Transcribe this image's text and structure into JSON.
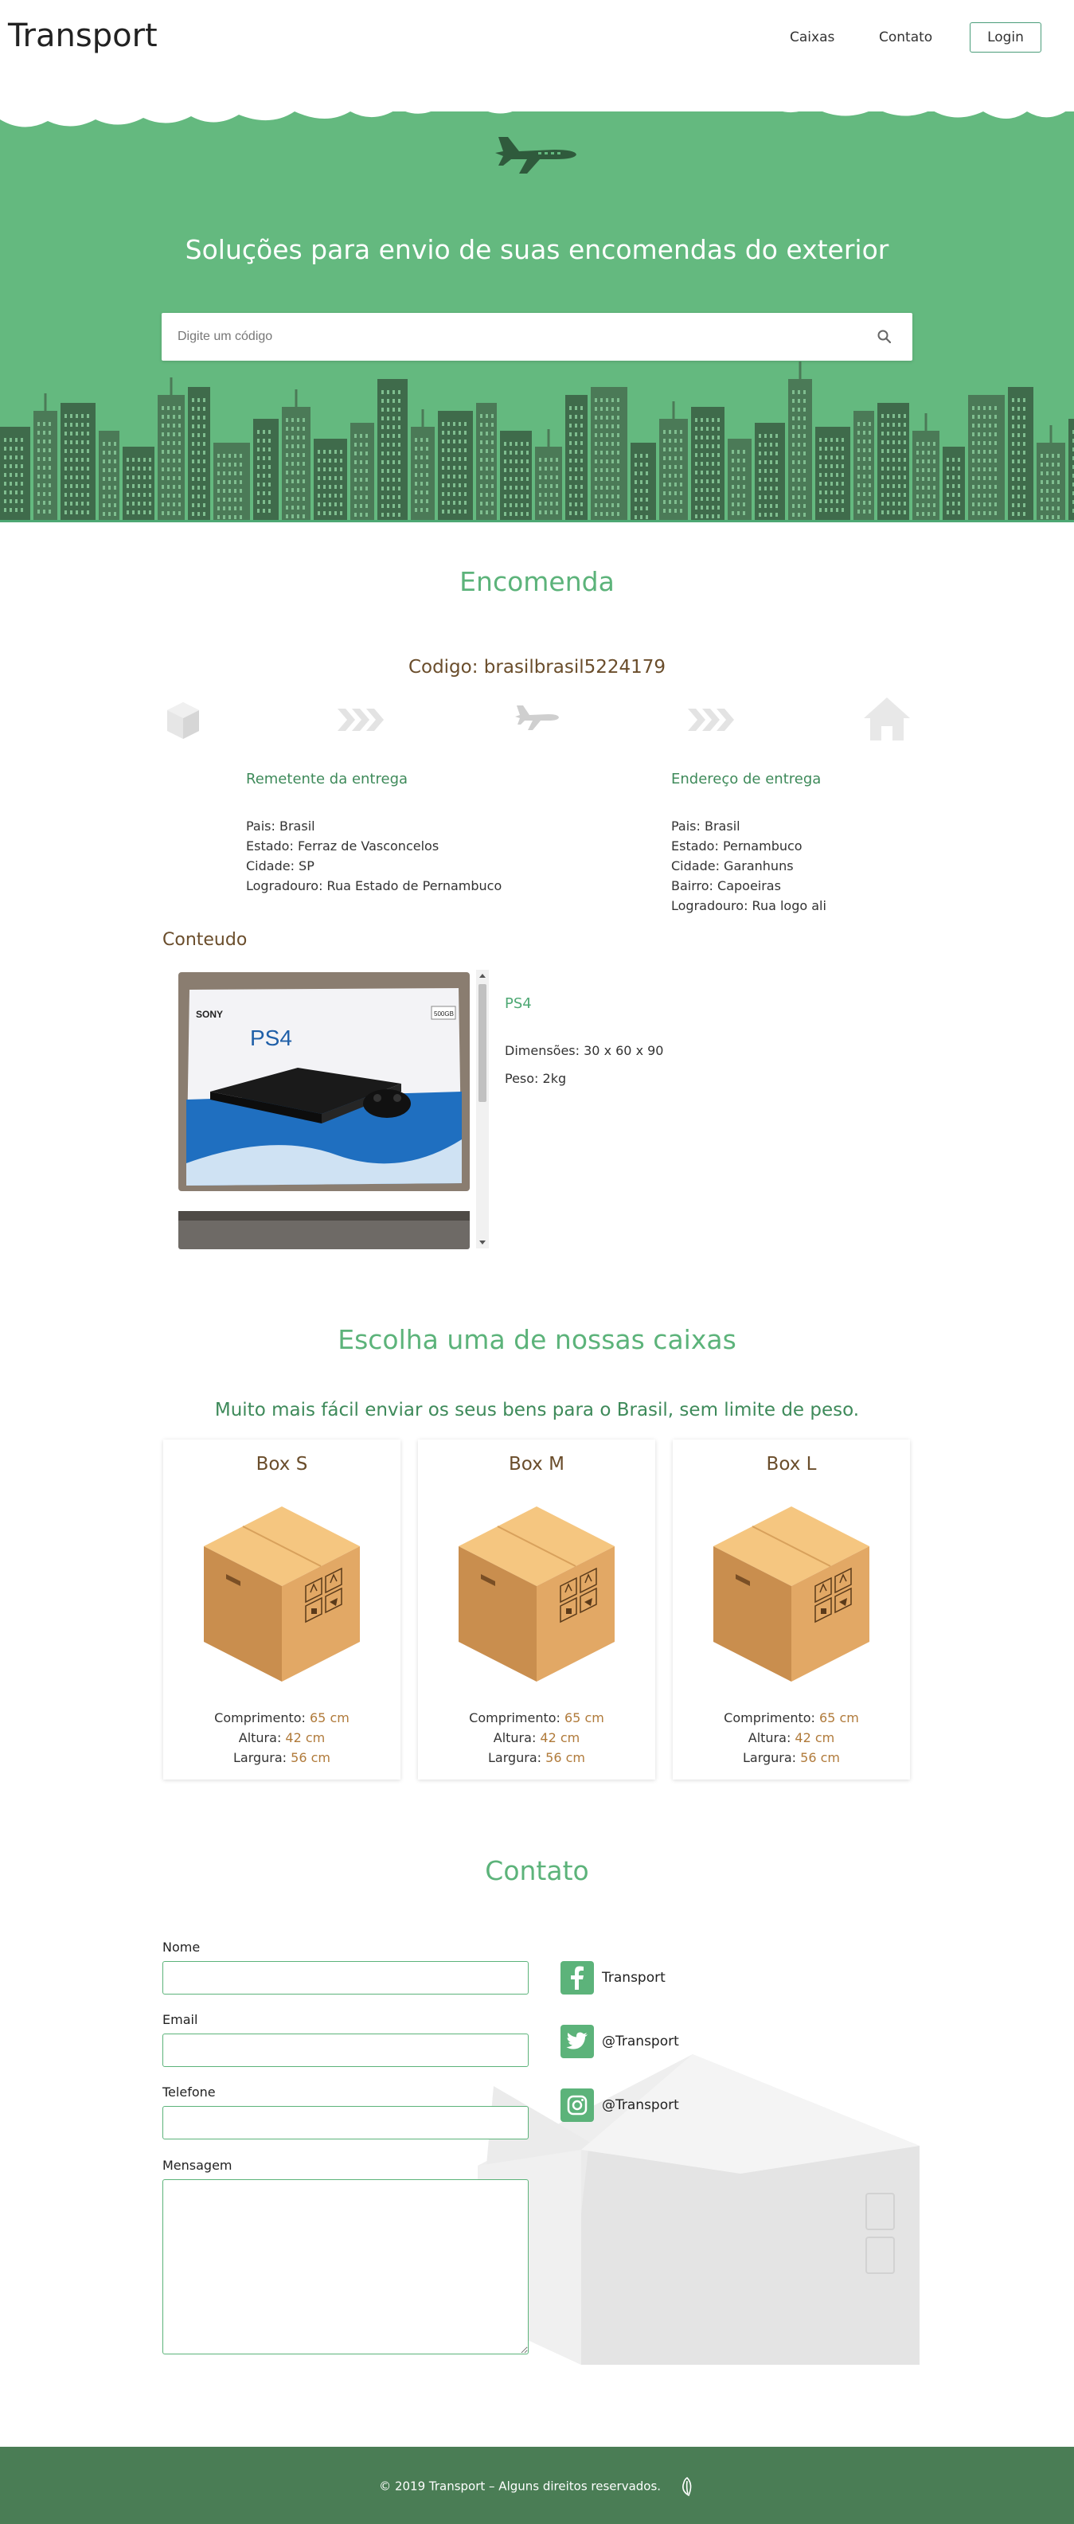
{
  "header": {
    "logo": "Transport",
    "nav": {
      "caixas": "Caixas",
      "contato": "Contato",
      "login": "Login"
    }
  },
  "hero": {
    "title": "Soluções para envio de suas encomendas do exterior",
    "search_placeholder": "Digite um código"
  },
  "encomenda": {
    "title": "Encomenda",
    "codigo": "Codigo: brasilbrasil5224179",
    "remetente": {
      "title": "Remetente da entrega",
      "lines": [
        "Pais: Brasil",
        "Estado: Ferraz de Vasconcelos",
        "Cidade: SP",
        "Logradouro: Rua Estado de Pernambuco"
      ]
    },
    "endereco": {
      "title": "Endereço de entrega",
      "lines": [
        "Pais: Brasil",
        "Estado: Pernambuco",
        "Cidade: Garanhuns",
        "Bairro: Capoeiras",
        "Logradouro: Rua logo ali"
      ]
    },
    "conteudo": {
      "title": "Conteudo",
      "product_name": "PS4",
      "dimensoes": "Dimensões: 30 x 60 x 90",
      "peso": "Peso: 2kg",
      "image_brand": "SONY",
      "image_logo": "PS4",
      "image_capacity": "500GB"
    }
  },
  "caixas": {
    "title": "Escolha uma de nossas caixas",
    "subtitle": "Muito mais fácil enviar os seus bens para o Brasil, sem limite de peso.",
    "boxes": [
      {
        "name": "Box S",
        "comp_label": "Comprimento:",
        "comp": "65 cm",
        "alt_label": "Altura:",
        "alt": "42 cm",
        "larg_label": "Largura:",
        "larg": "56 cm"
      },
      {
        "name": "Box M",
        "comp_label": "Comprimento:",
        "comp": "65 cm",
        "alt_label": "Altura:",
        "alt": "42 cm",
        "larg_label": "Largura:",
        "larg": "56 cm"
      },
      {
        "name": "Box L",
        "comp_label": "Comprimento:",
        "comp": "65 cm",
        "alt_label": "Altura:",
        "alt": "42 cm",
        "larg_label": "Largura:",
        "larg": "56 cm"
      }
    ]
  },
  "contato": {
    "title": "Contato",
    "nome_label": "Nome",
    "email_label": "Email",
    "telefone_label": "Telefone",
    "mensagem_label": "Mensagem",
    "social": {
      "facebook": "Transport",
      "twitter": "@Transport",
      "instagram": "@Transport"
    }
  },
  "footer": {
    "text": "© 2019 Transport – Alguns direitos reservados."
  },
  "colors": {
    "brand_green": "#64b97f",
    "dark_green": "#4a7d55",
    "brown": "#6a4d2b",
    "accent_value": "#b07a3a"
  }
}
